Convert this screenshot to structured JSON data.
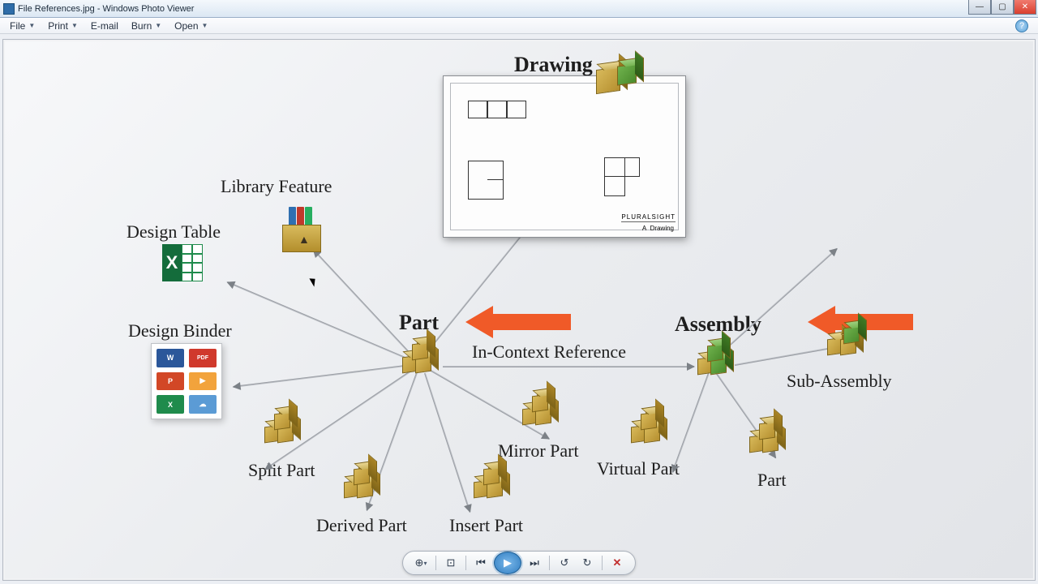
{
  "title": "File References.jpg - Windows Photo Viewer",
  "menu": {
    "file": "File",
    "print": "Print",
    "email": "E-mail",
    "burn": "Burn",
    "open": "Open"
  },
  "diagram": {
    "drawing": "Drawing",
    "library_feature": "Library Feature",
    "design_table": "Design Table",
    "design_binder": "Design Binder",
    "part": "Part",
    "assembly": "Assembly",
    "sub_assembly": "Sub-Assembly",
    "in_context_ref": "In-Context Reference",
    "split_part": "Split Part",
    "derived_part": "Derived Part",
    "insert_part": "Insert Part",
    "mirror_part": "Mirror Part",
    "virtual_part": "Virtual Part",
    "part2": "Part"
  },
  "drawing_panel": {
    "brand": "PLURALSIGHT",
    "caption": "Drawing",
    "mark_a": "A"
  },
  "binder_icons": {
    "word": "W",
    "pdf": "PDF",
    "ppt": "P",
    "play": "▶",
    "xls": "X",
    "cloud": "☁"
  },
  "toolbar": {
    "zoom": "⊕",
    "fit": "⊡",
    "prev": "⏮",
    "slideshow": "▶",
    "next": "⏭",
    "rotate_ccw": "↺",
    "rotate_cw": "↻",
    "delete": "✕"
  },
  "help": "?"
}
